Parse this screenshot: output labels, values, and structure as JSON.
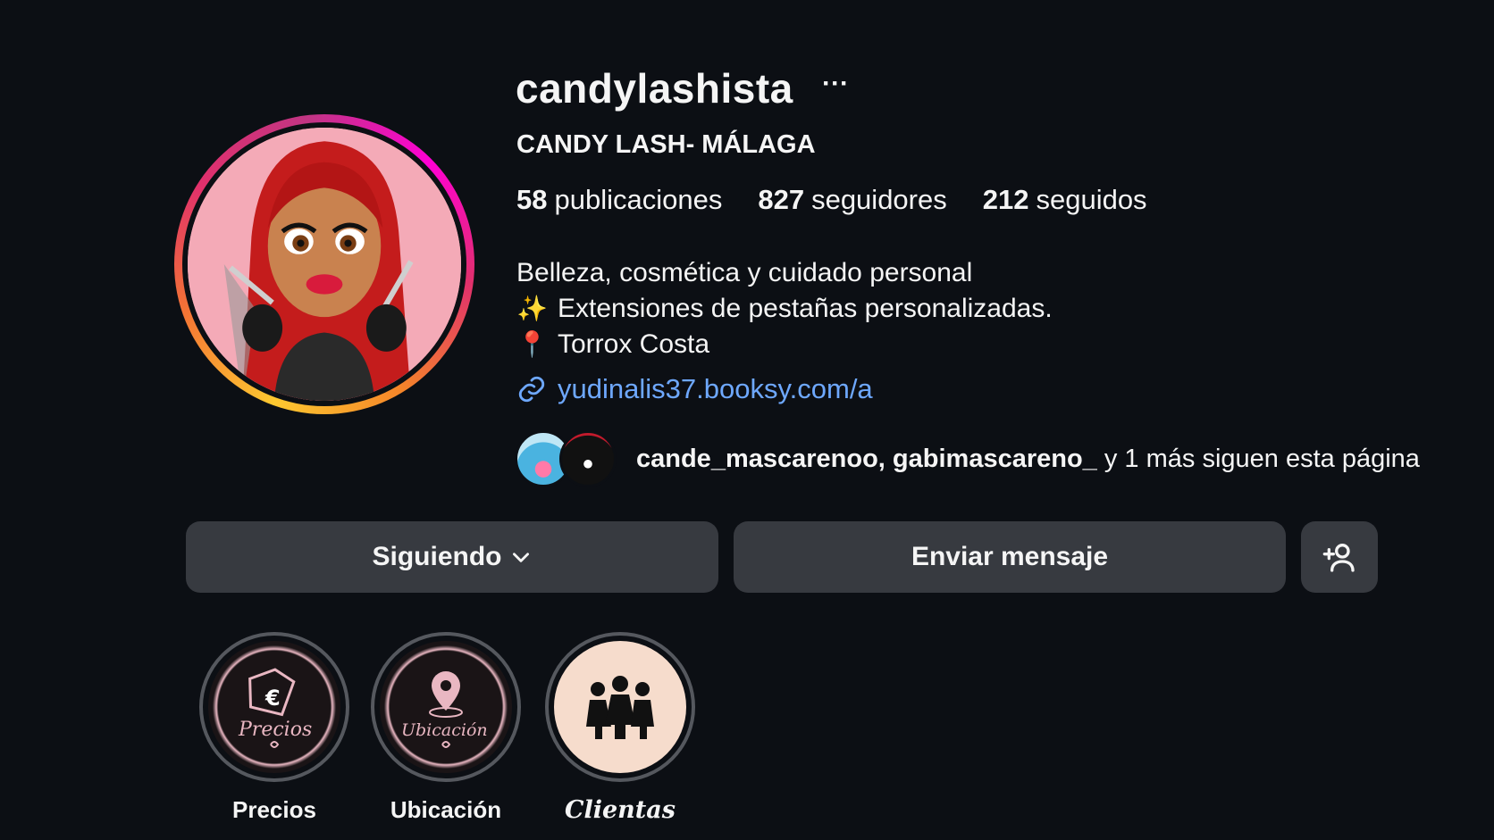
{
  "profile": {
    "username": "candylashista",
    "more_glyph": "···",
    "full_name": "CANDY LASH- MÁLAGA",
    "stats": {
      "posts_count": "58",
      "posts_label": "publicaciones",
      "followers_count": "827",
      "followers_label": "seguidores",
      "following_count": "212",
      "following_label": "seguidos"
    },
    "category": "Belleza, cosmética y cuidado personal",
    "bio_line1_emoji": "✨",
    "bio_line1": "Extensiones de pestañas personalizadas.",
    "bio_line2_emoji": "📍",
    "bio_line2": "Torrox Costa",
    "link": "yudinalis37.booksy.com/a",
    "mutual": {
      "names": "cande_mascarenoo, gabimascareno_",
      "suffix": "y 1 más siguen esta página"
    }
  },
  "actions": {
    "following_label": "Siguiendo",
    "message_label": "Enviar mensaje"
  },
  "highlights": [
    {
      "label": "Precios",
      "cover_text": "Precios",
      "icon": "price-tag-euro-icon"
    },
    {
      "label": "Ubicación",
      "cover_text": "Ubicación",
      "icon": "location-pin-icon"
    },
    {
      "label": "Clientas",
      "icon": "three-women-icon"
    }
  ],
  "colors": {
    "background": "#0c0f14",
    "button": "#373a40",
    "link": "#6ea8fe",
    "highlight_accent": "#e9b7c2"
  }
}
